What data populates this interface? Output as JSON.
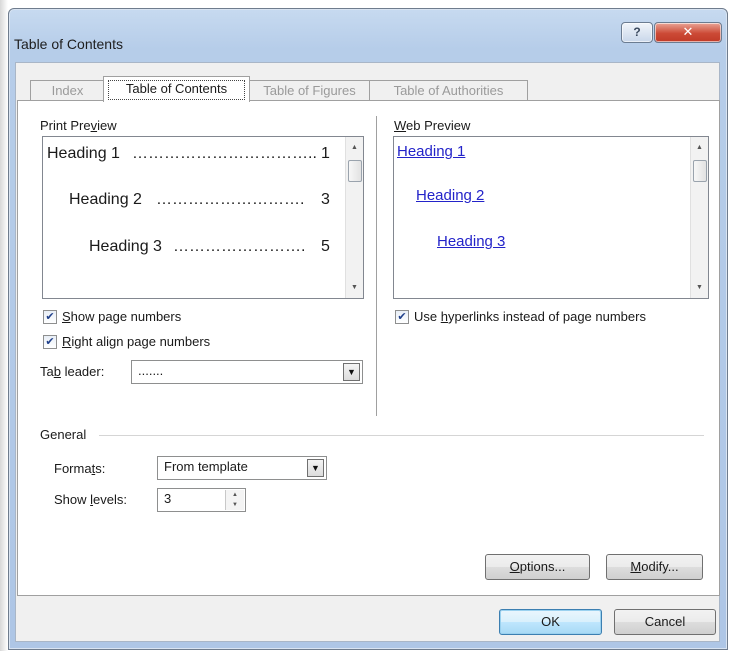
{
  "window": {
    "title": "Table of Contents",
    "help_button": "?",
    "close_button": "✕"
  },
  "tabs": [
    {
      "label": "Index",
      "active": false
    },
    {
      "label": "Table of Contents",
      "active": true
    },
    {
      "label": "Table of Figures",
      "active": false
    },
    {
      "label": "Table of Authorities",
      "active": false
    }
  ],
  "print_preview": {
    "label_pre": "Print Pre",
    "label_hotkey": "v",
    "label_post": "iew",
    "entries": [
      {
        "heading": "Heading 1",
        "page": "1"
      },
      {
        "heading": "Heading 2",
        "page": "3"
      },
      {
        "heading": "Heading 3",
        "page": "5"
      }
    ]
  },
  "web_preview": {
    "label_hotkey": "W",
    "label_post": "eb Preview",
    "links": [
      "Heading 1",
      "Heading 2",
      "Heading 3"
    ]
  },
  "options": {
    "show_page_numbers": {
      "pre": "",
      "hotkey": "S",
      "post": "how page numbers",
      "checked": true
    },
    "right_align": {
      "pre": "",
      "hotkey": "R",
      "post": "ight align page numbers",
      "checked": true
    },
    "use_hyperlinks": {
      "pre": "Use ",
      "hotkey": "h",
      "post": "yperlinks instead of page numbers",
      "checked": true
    },
    "tab_leader": {
      "label_pre": "Ta",
      "label_hotkey": "b",
      "label_post": " leader:",
      "value": "......."
    }
  },
  "general": {
    "heading": "General",
    "formats": {
      "label_pre": "Forma",
      "label_hotkey": "t",
      "label_post": "s:",
      "value": "From template"
    },
    "show_levels": {
      "label_pre": "Show ",
      "label_hotkey": "l",
      "label_post": "evels:",
      "value": "3"
    }
  },
  "buttons": {
    "options": {
      "hotkey": "O",
      "post": "ptions..."
    },
    "modify": {
      "hotkey": "M",
      "post": "odify..."
    },
    "ok": "OK",
    "cancel": "Cancel"
  },
  "icons": {
    "checkmark": "✔",
    "dropdown": "▼",
    "scroll_up": "▲",
    "scroll_down": "▼"
  }
}
